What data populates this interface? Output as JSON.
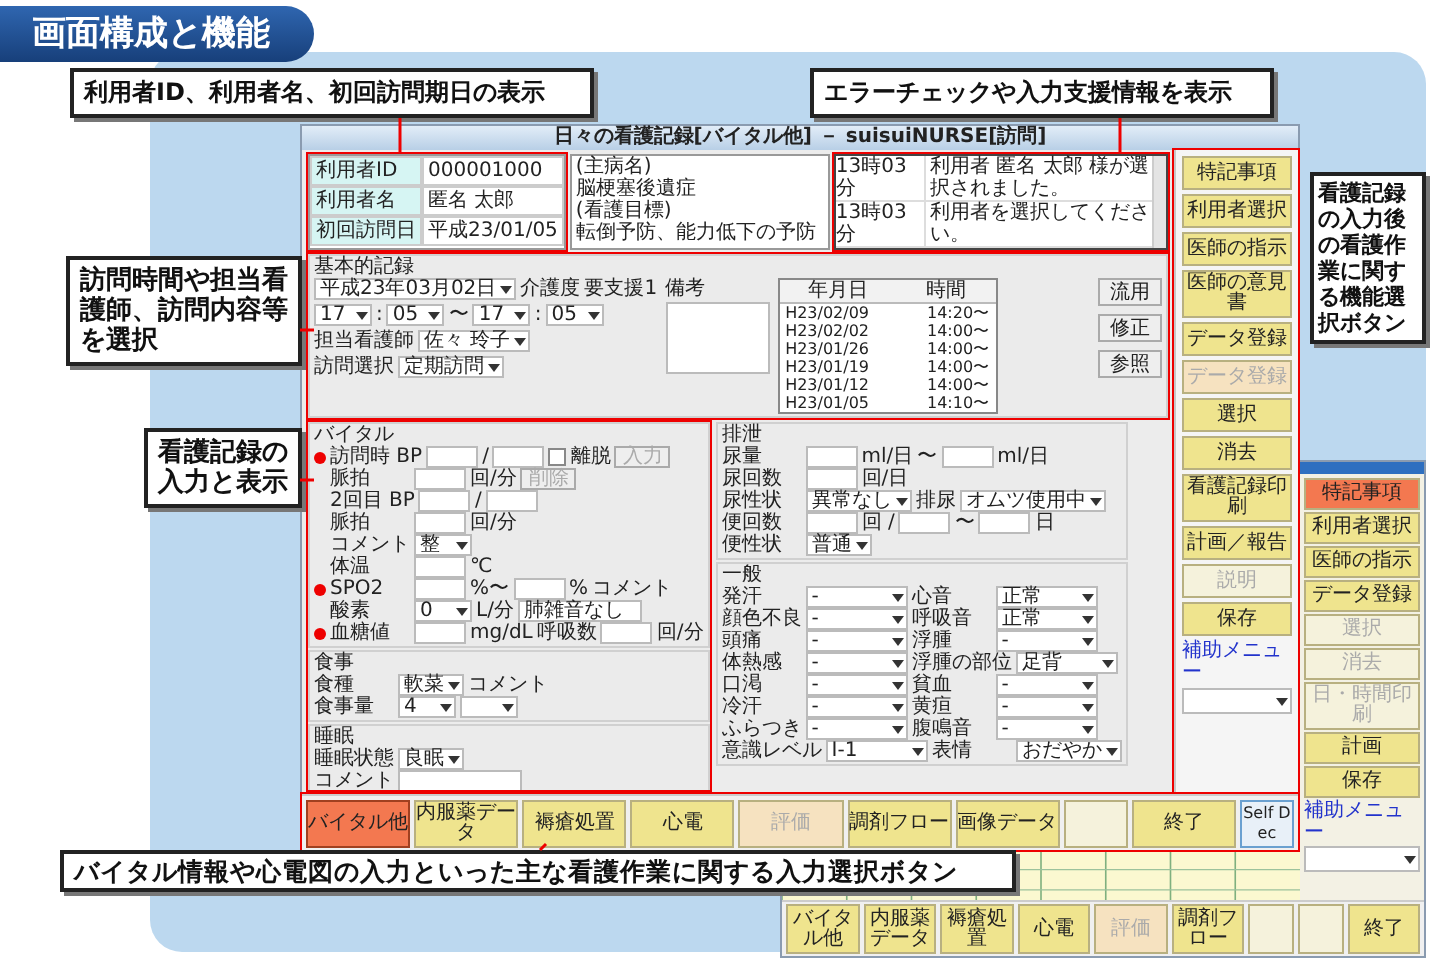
{
  "title_badge": "画面構成と機能",
  "callouts": [
    "利用者ID、利用者名、初回訪問期日の表示",
    "エラーチェックや入力支援情報を表示",
    "看護記録の入力後の看護作業に関する機能選択ボタン",
    "訪問時間や担当看護師、訪問内容等を選択",
    "看護記録の入力と表示",
    "バイタル情報や心電図の入力といった主な看護作業に関する入力選択ボタン"
  ],
  "main_window": {
    "title": "日々の看護記録[バイタル他] － suisuiNURSE[訪問]",
    "patient": [
      {
        "label": "利用者ID",
        "value": "000001000"
      },
      {
        "label": "利用者名",
        "value": "匿名 太郎"
      },
      {
        "label": "初回訪問日",
        "value": "平成23/01/05"
      }
    ],
    "notes": [
      "(主病名)",
      "脳梗塞後遺症",
      "(看護目標)",
      "転倒予防、能力低下の予防"
    ],
    "log": [
      {
        "time": "13時03分",
        "message": "利用者 匿名 太郎 様が選択されました。"
      },
      {
        "time": "13時03分",
        "message": "利用者を選択してください。"
      }
    ],
    "basic": {
      "heading": "基本的記録",
      "rows": [
        {
          "parts": [
            {
              "kind": "date",
              "value": "平成23年03月02日"
            },
            {
              "kind": "unit",
              "text": "介護度"
            },
            {
              "kind": "text",
              "text": "要支援1"
            }
          ]
        },
        {
          "parts": [
            {
              "kind": "select",
              "value": "17"
            },
            {
              "kind": "unit",
              "text": ":"
            },
            {
              "kind": "select",
              "value": "05"
            },
            {
              "kind": "unit",
              "text": "〜"
            },
            {
              "kind": "select",
              "value": "17"
            },
            {
              "kind": "unit",
              "text": ":"
            },
            {
              "kind": "select",
              "value": "05"
            }
          ]
        },
        {
          "parts": [
            {
              "kind": "label",
              "text": "担当看護師"
            },
            {
              "kind": "select",
              "value": "佐々 玲子"
            }
          ]
        },
        {
          "parts": [
            {
              "kind": "label",
              "text": "訪問選択"
            },
            {
              "kind": "select",
              "value": "定期訪問"
            }
          ]
        }
      ],
      "remarks_label": "備考",
      "history_columns": [
        "年月日",
        "時間"
      ],
      "history": [
        {
          "date": "H23/02/09",
          "time": "14:20〜"
        },
        {
          "date": "H23/02/02",
          "time": "14:00〜"
        },
        {
          "date": "H23/01/26",
          "time": "14:00〜"
        },
        {
          "date": "H23/01/19",
          "time": "14:00〜"
        },
        {
          "date": "H23/01/12",
          "time": "14:00〜"
        },
        {
          "date": "H23/01/05",
          "time": "14:10〜"
        }
      ],
      "buttons": [
        "流用",
        "修正",
        "参照"
      ]
    },
    "left_sections": [
      {
        "heading": "バイタル",
        "rows": [
          {
            "required": true,
            "parts": [
              {
                "kind": "label",
                "text": "訪問時 BP"
              },
              {
                "kind": "input"
              },
              {
                "kind": "unit",
                "text": "/"
              },
              {
                "kind": "input"
              },
              {
                "kind": "check",
                "label": "離脱",
                "checked": false
              },
              {
                "kind": "button",
                "label": "入力",
                "disabled": true
              }
            ]
          },
          {
            "required": false,
            "parts": [
              {
                "kind": "label",
                "text": "脈拍"
              },
              {
                "kind": "input"
              },
              {
                "kind": "unit",
                "text": "回/分"
              },
              {
                "kind": "button",
                "label": "削除",
                "disabled": true
              }
            ]
          },
          {
            "required": false,
            "parts": [
              {
                "kind": "label",
                "text": "2回目 BP"
              },
              {
                "kind": "input"
              },
              {
                "kind": "unit",
                "text": "/"
              },
              {
                "kind": "input"
              }
            ]
          },
          {
            "required": false,
            "parts": [
              {
                "kind": "label",
                "text": "脈拍"
              },
              {
                "kind": "input"
              },
              {
                "kind": "unit",
                "text": "回/分"
              }
            ]
          },
          {
            "required": false,
            "parts": [
              {
                "kind": "label",
                "text": "コメント"
              },
              {
                "kind": "select",
                "value": "整"
              }
            ]
          },
          {
            "required": false,
            "parts": [
              {
                "kind": "label",
                "text": "体温"
              },
              {
                "kind": "input"
              },
              {
                "kind": "unit",
                "text": "℃"
              }
            ]
          },
          {
            "required": true,
            "parts": [
              {
                "kind": "label",
                "text": "SPO2"
              },
              {
                "kind": "input"
              },
              {
                "kind": "unit",
                "text": "%〜"
              },
              {
                "kind": "input"
              },
              {
                "kind": "unit",
                "text": "%"
              },
              {
                "kind": "unit",
                "text": "コメント"
              }
            ]
          },
          {
            "required": false,
            "parts": [
              {
                "kind": "label",
                "text": "酸素"
              },
              {
                "kind": "select",
                "value": "0"
              },
              {
                "kind": "unit",
                "text": "L/分"
              },
              {
                "kind": "field",
                "value": "肺雑音なし"
              }
            ]
          },
          {
            "required": true,
            "parts": [
              {
                "kind": "label",
                "text": "血糖値"
              },
              {
                "kind": "input"
              },
              {
                "kind": "unit",
                "text": "mg/dL"
              },
              {
                "kind": "unit",
                "text": "呼吸数"
              },
              {
                "kind": "input"
              },
              {
                "kind": "unit",
                "text": "回/分"
              }
            ]
          }
        ]
      },
      {
        "heading": "食事",
        "rows": [
          {
            "parts": [
              {
                "kind": "label",
                "text": "食種"
              },
              {
                "kind": "select",
                "value": "軟菜"
              },
              {
                "kind": "unit",
                "text": "コメント"
              }
            ]
          },
          {
            "parts": [
              {
                "kind": "label",
                "text": "食事量"
              },
              {
                "kind": "select",
                "value": "4"
              },
              {
                "kind": "select"
              }
            ]
          }
        ]
      },
      {
        "heading": "睡眠",
        "rows": [
          {
            "parts": [
              {
                "kind": "label",
                "text": "睡眠状態"
              },
              {
                "kind": "select",
                "value": "良眠"
              }
            ]
          },
          {
            "parts": [
              {
                "kind": "label",
                "text": "コメント"
              },
              {
                "kind": "field"
              }
            ]
          }
        ]
      }
    ],
    "right_sections": [
      {
        "heading": "排泄",
        "rows": [
          {
            "parts": [
              {
                "kind": "label",
                "text": "尿量"
              },
              {
                "kind": "input"
              },
              {
                "kind": "unit",
                "text": "ml/日"
              },
              {
                "kind": "unit",
                "text": "〜"
              },
              {
                "kind": "input"
              },
              {
                "kind": "unit",
                "text": "ml/日"
              }
            ]
          },
          {
            "parts": [
              {
                "kind": "label",
                "text": "尿回数"
              },
              {
                "kind": "input"
              },
              {
                "kind": "unit",
                "text": "回/日"
              }
            ]
          },
          {
            "parts": [
              {
                "kind": "label",
                "text": "尿性状"
              },
              {
                "kind": "select",
                "value": "異常なし"
              },
              {
                "kind": "unit",
                "text": "排尿"
              },
              {
                "kind": "select",
                "value": "オムツ使用中"
              }
            ]
          },
          {
            "parts": [
              {
                "kind": "label",
                "text": "便回数"
              },
              {
                "kind": "input"
              },
              {
                "kind": "unit",
                "text": "回 /"
              },
              {
                "kind": "input"
              },
              {
                "kind": "unit",
                "text": "〜"
              },
              {
                "kind": "input"
              },
              {
                "kind": "unit",
                "text": "日"
              }
            ]
          },
          {
            "parts": [
              {
                "kind": "label",
                "text": "便性状"
              },
              {
                "kind": "select",
                "value": "普通"
              }
            ]
          }
        ]
      },
      {
        "heading": "一般",
        "rows": [
          {
            "parts": [
              {
                "kind": "label",
                "text": "発汗"
              },
              {
                "kind": "select",
                "value": "-"
              },
              {
                "kind": "label",
                "text": "心音"
              },
              {
                "kind": "select",
                "value": "正常"
              }
            ]
          },
          {
            "parts": [
              {
                "kind": "label",
                "text": "顔色不良"
              },
              {
                "kind": "select",
                "value": "-"
              },
              {
                "kind": "label",
                "text": "呼吸音"
              },
              {
                "kind": "select",
                "value": "正常"
              }
            ]
          },
          {
            "parts": [
              {
                "kind": "label",
                "text": "頭痛"
              },
              {
                "kind": "select",
                "value": "-"
              },
              {
                "kind": "label",
                "text": "浮腫"
              },
              {
                "kind": "select",
                "value": "-"
              }
            ]
          },
          {
            "parts": [
              {
                "kind": "label",
                "text": "体熱感"
              },
              {
                "kind": "select",
                "value": "-"
              },
              {
                "kind": "label",
                "text": "浮腫の部位"
              },
              {
                "kind": "select",
                "value": "足背"
              }
            ]
          },
          {
            "parts": [
              {
                "kind": "label",
                "text": "口渇"
              },
              {
                "kind": "select",
                "value": "-"
              },
              {
                "kind": "label",
                "text": "貧血"
              },
              {
                "kind": "select",
                "value": "-"
              }
            ]
          },
          {
            "parts": [
              {
                "kind": "label",
                "text": "冷汗"
              },
              {
                "kind": "select",
                "value": "-"
              },
              {
                "kind": "label",
                "text": "黄疸"
              },
              {
                "kind": "select",
                "value": "-"
              }
            ]
          },
          {
            "parts": [
              {
                "kind": "label",
                "text": "ふらつき"
              },
              {
                "kind": "select",
                "value": "-"
              },
              {
                "kind": "label",
                "text": "腹鳴音"
              },
              {
                "kind": "select",
                "value": "-"
              }
            ]
          },
          {
            "parts": [
              {
                "kind": "label",
                "text": "意識レベル"
              },
              {
                "kind": "select",
                "value": "I-1"
              },
              {
                "kind": "label",
                "text": "表情"
              },
              {
                "kind": "select",
                "value": "おだやか"
              }
            ]
          }
        ]
      }
    ],
    "side_buttons": [
      {
        "label": "特記事項",
        "disabled": false,
        "color": "#efe48e"
      },
      {
        "label": "利用者選択",
        "disabled": false,
        "color": "#efe48e"
      },
      {
        "label": "医師の指示",
        "disabled": false,
        "color": "#efe48e"
      },
      {
        "label": "医師の意見書",
        "disabled": false,
        "color": "#efe48e"
      },
      {
        "label": "データ登録",
        "disabled": false,
        "color": "#efe48e"
      },
      {
        "label": "データ登録",
        "disabled": true,
        "color": "#f6e2c0"
      },
      {
        "label": "選択",
        "disabled": false,
        "color": "#efe48e"
      },
      {
        "label": "消去",
        "disabled": false,
        "color": "#efe48e"
      },
      {
        "label": "看護記録印刷",
        "disabled": false,
        "color": "#efe48e"
      },
      {
        "label": "計画／報告",
        "disabled": false,
        "color": "#efe48e"
      },
      {
        "label": "説明",
        "disabled": true,
        "color": "#f5f2dc"
      },
      {
        "label": "保存",
        "disabled": false,
        "color": "#efe48e"
      }
    ],
    "assist_menu_label": "補助メニュー",
    "bottom_buttons": [
      {
        "kind": "normal",
        "label": "バイタル他",
        "selected": true,
        "disabled": false,
        "color": "#f37850"
      },
      {
        "kind": "normal",
        "label": "内服薬データ",
        "selected": false,
        "disabled": false,
        "color": "#efe48e"
      },
      {
        "kind": "normal",
        "label": "褥瘡処置",
        "selected": false,
        "disabled": false,
        "color": "#efe48e"
      },
      {
        "kind": "normal",
        "label": "心電",
        "selected": false,
        "disabled": false,
        "color": "#efe48e"
      },
      {
        "kind": "normal",
        "label": "評価",
        "selected": false,
        "disabled": true,
        "color": "#f6e2c0"
      },
      {
        "kind": "normal",
        "label": "調剤フロー",
        "selected": false,
        "disabled": false,
        "color": "#efe48e"
      },
      {
        "kind": "normal",
        "label": "画像データ",
        "selected": false,
        "disabled": false,
        "color": "#efe48e"
      },
      {
        "kind": "blank",
        "selected": false,
        "color": "#f5f2dc"
      },
      {
        "kind": "normal",
        "label": "終了",
        "selected": false,
        "disabled": false,
        "color": "#efe48e"
      },
      {
        "kind": "self",
        "label": "Self Dec",
        "selected": false,
        "disabled": false,
        "color": "#e8f0f8"
      }
    ]
  },
  "background_window": {
    "side_buttons": [
      {
        "label": "特記事項",
        "disabled": false,
        "color": "#f37850"
      },
      {
        "label": "利用者選択",
        "disabled": false,
        "color": "#efe48e"
      },
      {
        "label": "医師の指示",
        "disabled": false,
        "color": "#efe48e"
      },
      {
        "label": "データ登録",
        "disabled": false,
        "color": "#efe48e"
      },
      {
        "label": "選択",
        "disabled": true,
        "color": "#f5f2dc"
      },
      {
        "label": "消去",
        "disabled": true,
        "color": "#f5f2dc"
      },
      {
        "label": "日・時間印刷",
        "disabled": true,
        "color": "#f5f2dc"
      },
      {
        "label": "計画",
        "disabled": false,
        "color": "#efe48e"
      },
      {
        "label": "保存",
        "disabled": false,
        "color": "#efe48e"
      }
    ],
    "assist_menu_label": "補助メニュー",
    "bottom_buttons": [
      {
        "kind": "normal",
        "label": "バイタル他",
        "selected": false,
        "disabled": false,
        "color": "#efe48e"
      },
      {
        "kind": "normal",
        "label": "内服薬データ",
        "selected": false,
        "disabled": false,
        "color": "#efe48e"
      },
      {
        "kind": "normal",
        "label": "褥瘡処置",
        "selected": false,
        "disabled": false,
        "color": "#efe48e"
      },
      {
        "kind": "normal",
        "label": "心電",
        "selected": false,
        "disabled": false,
        "color": "#efe48e"
      },
      {
        "kind": "normal",
        "label": "評価",
        "selected": false,
        "disabled": true,
        "color": "#f6e2c0"
      },
      {
        "kind": "normal",
        "label": "調剤フロー",
        "selected": false,
        "disabled": false,
        "color": "#efe48e"
      },
      {
        "kind": "blank",
        "selected": false,
        "color": "#f5f2dc"
      },
      {
        "kind": "blank",
        "selected": false,
        "color": "#f5f2dc"
      },
      {
        "kind": "normal",
        "label": "終了",
        "selected": false,
        "disabled": false,
        "color": "#efe48e"
      }
    ]
  }
}
